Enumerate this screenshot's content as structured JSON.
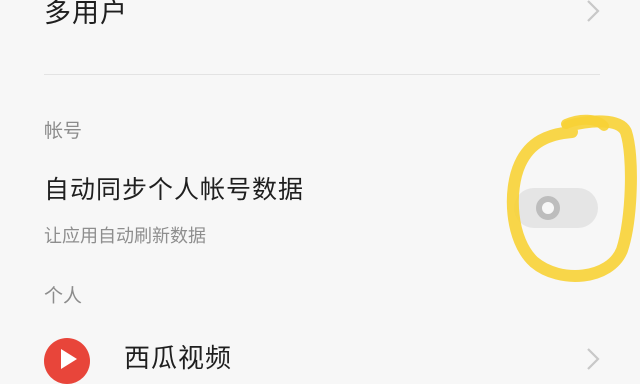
{
  "multi_user": {
    "label": "多用户"
  },
  "account_section": {
    "header": "帐号",
    "sync_item": {
      "title": "自动同步个人帐号数据",
      "subtitle": "让应用自动刷新数据",
      "toggle_state": "off"
    }
  },
  "personal_section": {
    "header": "个人",
    "app_item": {
      "label": "西瓜视频",
      "icon": "xigua-video-app-icon"
    }
  },
  "icons": {
    "chevron": "chevron-right-icon",
    "accent_highlight": "#f7d235",
    "toggle_off_track": "#e5e5e5"
  }
}
